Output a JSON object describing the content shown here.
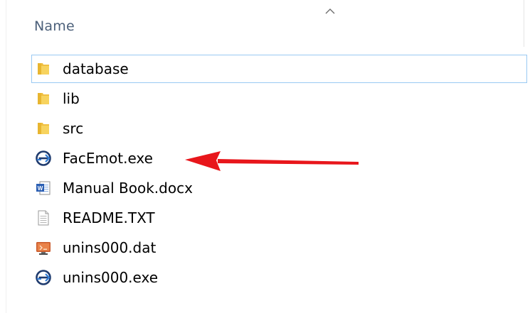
{
  "header": {
    "name_column": "Name",
    "sort_direction": "ascending"
  },
  "files": [
    {
      "name": "database",
      "icon": "folder-icon",
      "type": "folder",
      "focused": true
    },
    {
      "name": "lib",
      "icon": "folder-icon",
      "type": "folder",
      "focused": false
    },
    {
      "name": "src",
      "icon": "folder-icon",
      "type": "folder",
      "focused": false
    },
    {
      "name": "FacEmot.exe",
      "icon": "application-exe-icon",
      "type": "exe",
      "focused": false
    },
    {
      "name": "Manual Book.docx",
      "icon": "word-document-icon",
      "type": "docx",
      "focused": false
    },
    {
      "name": "README.TXT",
      "icon": "text-file-icon",
      "type": "txt",
      "focused": false
    },
    {
      "name": "unins000.dat",
      "icon": "data-file-icon",
      "type": "dat",
      "focused": false
    },
    {
      "name": "unins000.exe",
      "icon": "application-exe-icon",
      "type": "exe",
      "focused": false
    }
  ],
  "annotation": {
    "arrow_color": "#e8161b",
    "points_to": "FacEmot.exe"
  },
  "colors": {
    "header_text": "#4c607a",
    "folder": "#f0c042",
    "focus_border": "#99c9f3"
  }
}
